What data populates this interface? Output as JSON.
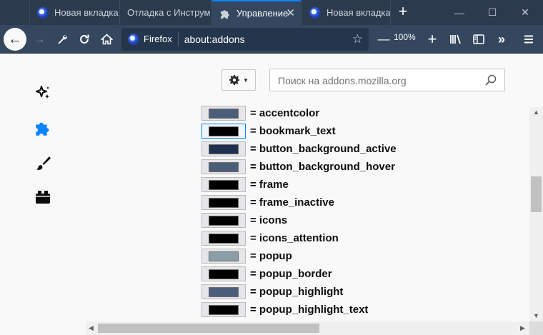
{
  "tabs": [
    {
      "label": "Новая вкладка",
      "icon": "firefox-icon"
    },
    {
      "label": "Отладка с Инструм",
      "icon": "none"
    },
    {
      "label": "Управление",
      "icon": "puzzle-icon",
      "active": true
    },
    {
      "label": "Новая вкладка",
      "icon": "firefox-icon"
    }
  ],
  "window_controls": {
    "minimize": "—",
    "maximize": "☐",
    "close": "✕"
  },
  "toolbar": {
    "identity_label": "Firefox",
    "url": "about:addons",
    "zoom": "100%"
  },
  "addons": {
    "search_placeholder": "Поиск на addons.mozilla.org",
    "sidebar": [
      "recommendations-icon",
      "extensions-icon",
      "themes-icon",
      "plugins-icon"
    ],
    "colors": [
      {
        "label": "= accentcolor",
        "color": "#4a5e7a"
      },
      {
        "label": "= bookmark_text",
        "color": "#000000",
        "focused": true
      },
      {
        "label": "= button_background_active",
        "color": "#1f3050"
      },
      {
        "label": "= button_background_hover",
        "color": "#4a5e7a"
      },
      {
        "label": "= frame",
        "color": "#000000"
      },
      {
        "label": "= frame_inactive",
        "color": "#000000"
      },
      {
        "label": "= icons",
        "color": "#000000"
      },
      {
        "label": "= icons_attention",
        "color": "#000000"
      },
      {
        "label": "= popup",
        "color": "#8a9ea8"
      },
      {
        "label": "= popup_border",
        "color": "#000000"
      },
      {
        "label": "= popup_highlight",
        "color": "#4a5e7a"
      },
      {
        "label": "= popup_highlight_text",
        "color": "#000000"
      }
    ]
  },
  "colors": {
    "accent": "#0a84ff",
    "toolbar": "#34475e",
    "tabstrip": "#2b3a4d"
  }
}
